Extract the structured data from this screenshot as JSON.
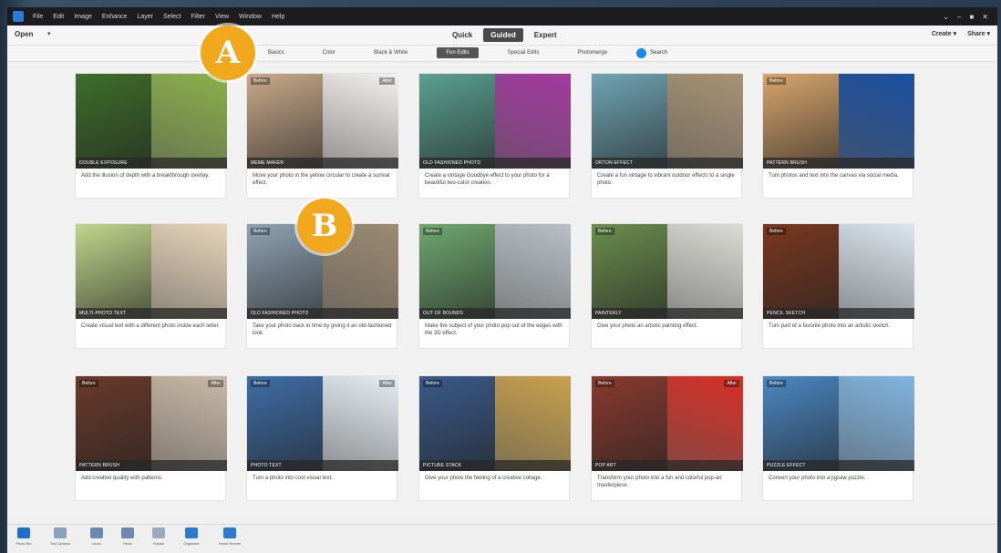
{
  "menubar": {
    "items": [
      "File",
      "Edit",
      "Image",
      "Enhance",
      "Layer",
      "Select",
      "Filter",
      "View",
      "Window",
      "Help"
    ],
    "window_controls": [
      "⌄",
      "–",
      "■",
      "✕"
    ]
  },
  "toolbar": {
    "open_label": "Open",
    "open_caret": "▾",
    "mode_tabs": [
      "Quick",
      "Guided",
      "Expert"
    ],
    "active_mode": "Guided",
    "create_label": "Create ▾",
    "share_label": "Share ▾"
  },
  "categories": {
    "tabs": [
      "Basics",
      "Color",
      "Black & White",
      "Fun Edits",
      "Special Edits",
      "Photomerge"
    ],
    "active": "Fun Edits",
    "search_label": "Search"
  },
  "badges": [
    "A",
    "B"
  ],
  "cards": [
    {
      "title": "DOUBLE EXPOSURE",
      "desc": "Add the illusion of depth with a breakthrough overlay.",
      "colors": [
        "#3e6e2a",
        "#8bb04a"
      ],
      "chips": [
        "",
        ""
      ]
    },
    {
      "title": "MEME MAKER",
      "desc": "Move your photo in the yellow circular to create a surreal effect.",
      "colors": [
        "#c9a98a",
        "#f4f1ee"
      ],
      "chips": [
        "Before",
        "After"
      ]
    },
    {
      "title": "OLD FASHIONED PHOTO",
      "desc": "Create a vintage Goodbye effect to your photo for a beautiful two-color creation.",
      "colors": [
        "#5aa090",
        "#a23aa0"
      ],
      "chips": [
        "",
        ""
      ]
    },
    {
      "title": "ORTON EFFECT",
      "desc": "Create a fun vintage to vibrant outdoor effects to a single photo.",
      "colors": [
        "#6fa4b4",
        "#a89274"
      ],
      "chips": [
        "",
        ""
      ]
    },
    {
      "title": "PATTERN BRUSH",
      "desc": "Turn photos and text into the canvas via social media.",
      "colors": [
        "#d8a56c",
        "#1a4fa0"
      ],
      "chips": [
        "Before",
        ""
      ]
    },
    {
      "title": "MULTI-PHOTO TEXT",
      "desc": "Create visual text with a different photo inside each letter.",
      "colors": [
        "#c0d68a",
        "#e7d4b8"
      ],
      "chips": [
        "",
        ""
      ]
    },
    {
      "title": "OLD FASHIONED PHOTO",
      "desc": "Take your photo back in time by giving it an old-fashioned look.",
      "colors": [
        "#8fa3b4",
        "#9c8a70"
      ],
      "chips": [
        "Before",
        ""
      ]
    },
    {
      "title": "OUT OF BOUNDS",
      "desc": "Make the subject of your photo pop out of the edges with the 3D effect.",
      "colors": [
        "#6fa86e",
        "#b8c0c6"
      ],
      "chips": [
        "Before",
        ""
      ]
    },
    {
      "title": "PAINTERLY",
      "desc": "Give your photo an artistic painting effect.",
      "colors": [
        "#6b8e4e",
        "#dcdcd6"
      ],
      "chips": [
        "Before",
        ""
      ]
    },
    {
      "title": "PENCIL SKETCH",
      "desc": "Turn part of a favorite photo into an artistic sketch.",
      "colors": [
        "#7a3820",
        "#dce6ee"
      ],
      "chips": [
        "Before",
        ""
      ]
    },
    {
      "title": "PATTERN BRUSH",
      "desc": "Add creative quality with patterns.",
      "colors": [
        "#6a3a2a",
        "#c9b9a6"
      ],
      "chips": [
        "Before",
        "After"
      ]
    },
    {
      "title": "PHOTO TEXT",
      "desc": "Turn a photo into cool visual text.",
      "colors": [
        "#3f6ea8",
        "#e6eef4"
      ],
      "chips": [
        "Before",
        "After"
      ]
    },
    {
      "title": "PICTURE STACK",
      "desc": "Give your photo the feeling of a creative collage.",
      "colors": [
        "#3a5a8a",
        "#c7a04c"
      ],
      "chips": [
        "Before",
        ""
      ]
    },
    {
      "title": "POP ART",
      "desc": "Transform your photo into a fun and colorful pop-art masterpiece.",
      "colors": [
        "#8a3a2e",
        "#d73025"
      ],
      "chips": [
        "Before",
        "After"
      ]
    },
    {
      "title": "PUZZLE EFFECT",
      "desc": "Convert your photo into a jigsaw puzzle.",
      "colors": [
        "#4a88c4",
        "#7fb4e0"
      ],
      "chips": [
        "Before",
        ""
      ]
    }
  ],
  "bottombar": {
    "items": [
      {
        "label": "Photo Bin",
        "color": "#1e6fd0"
      },
      {
        "label": "Tool Options",
        "color": "#8aa0c0"
      },
      {
        "label": "Undo",
        "color": "#6b8ab0"
      },
      {
        "label": "Redo",
        "color": "#6b8ab0"
      },
      {
        "label": "Rotate",
        "color": "#9aaac0"
      },
      {
        "label": "Organizer",
        "color": "#2a7ad0"
      },
      {
        "label": "Home Screen",
        "color": "#2a7ad0"
      }
    ]
  }
}
